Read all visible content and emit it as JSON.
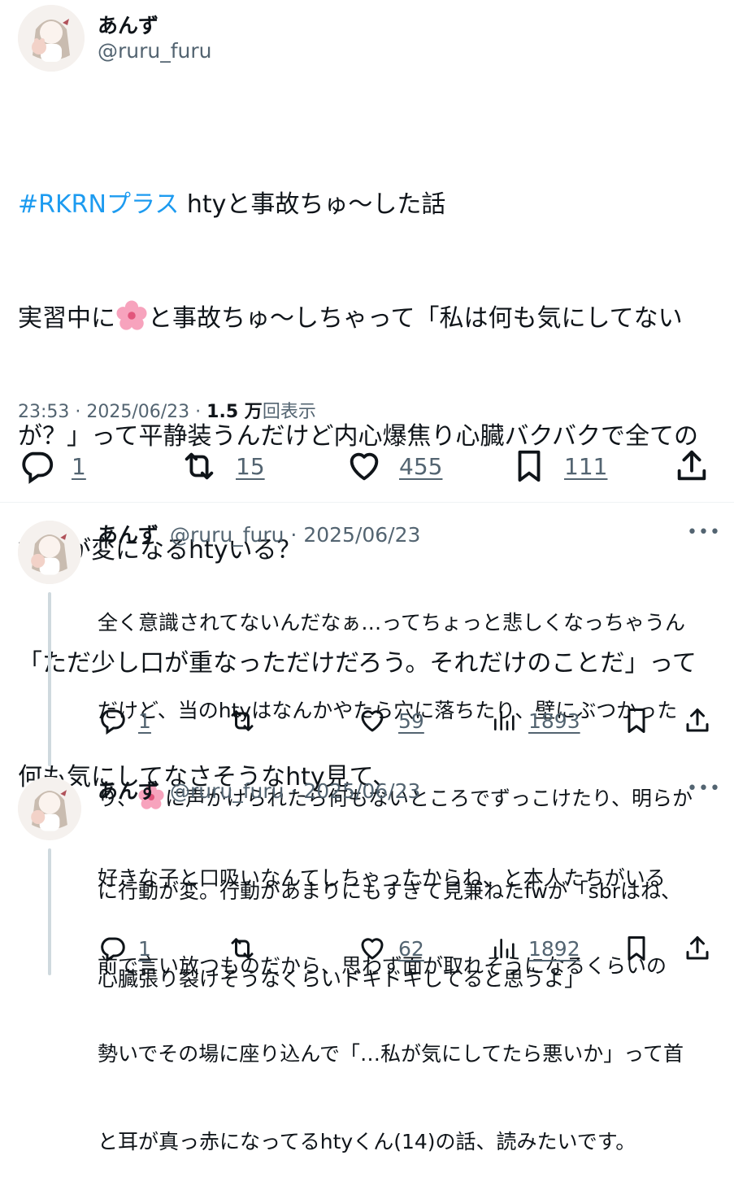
{
  "main": {
    "author": {
      "name": "あんず",
      "handle": "@ruru_furu"
    },
    "hashtag": "#RKRNプラス",
    "title_rest": " htyと事故ちゅ〜した話",
    "body_lines": [
      "実習中に",
      "と事故ちゅ〜しちゃって「私は何も気にしてない",
      "が？」って平静装うんだけど内心爆焦り心臓バクバクで全ての",
      "行動が変になるhtyいる？",
      "「ただ少し口が重なっただけだろう。それだけのことだ」って",
      "何も気にしてなさそうなhty見て、"
    ],
    "meta": {
      "time": "23:53 · 2025/06/23 · ",
      "views": "1.5 万",
      "views_label": "回表示"
    },
    "actions": {
      "replies": "1",
      "reposts": "15",
      "likes": "455",
      "bookmarks": "111"
    },
    "icons": [
      "reply-icon",
      "repost-icon",
      "like-icon",
      "bookmark-icon",
      "share-icon"
    ]
  },
  "replies": [
    {
      "name": "あんず",
      "handle_date": "@ruru_furu · 2025/06/23",
      "lines": [
        "全く意識されてないんだなぁ…ってちょっと悲しくなっちゃうん",
        "だけど、当のhtyはなんかやたら穴に落ちたり、壁にぶつかった",
        "り、",
        "に声かけられたら何もないところでずっこけたり、明らか",
        "に行動が変。行動があまりにもすぎて見兼ねたfwが「sbrはね、",
        "心臓張り裂けそうなくらいドキドキしてると思うよ」"
      ],
      "actions": {
        "replies": "1",
        "likes": "59",
        "views": "1893"
      }
    },
    {
      "name": "あんず",
      "handle_date": "@ruru_furu · 2025/06/23",
      "lines": [
        "好きな子と口吸いなんてしちゃったからね、と本人たちがいる",
        "前で言い放つものだから、思わず面が取れそうになるくらいの",
        "勢いでその場に座り込んで「…私が気にしてたら悪いか」って首",
        "と耳が真っ赤になってるhtyくん(14)の話、読みたいです。"
      ],
      "actions": {
        "replies": "1",
        "likes": "62",
        "views": "1892"
      }
    }
  ],
  "colors": {
    "text": "#0f1419",
    "secondary": "#536471",
    "link": "#1d9bf0",
    "divider": "#eff3f4",
    "thread": "#cfd9de"
  }
}
